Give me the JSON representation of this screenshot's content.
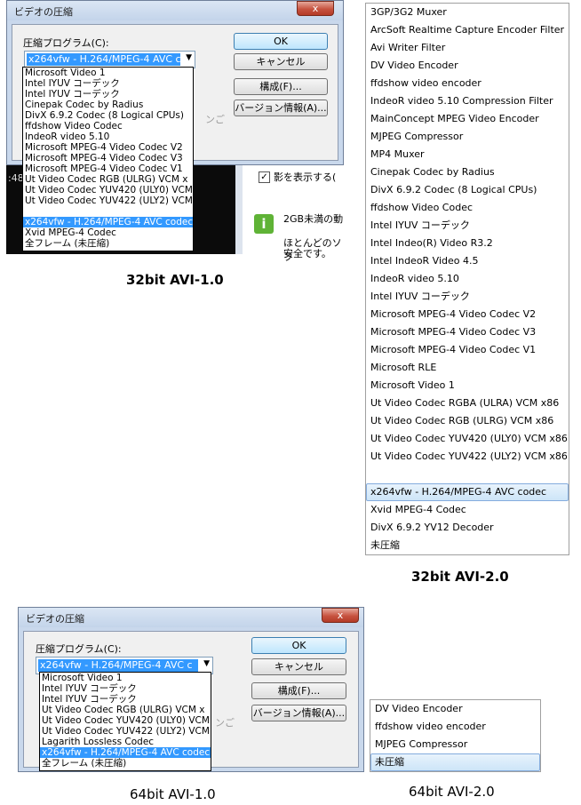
{
  "dialog_title": "ビデオの圧縮",
  "close_glyph": "x",
  "compressor_label": "圧縮プログラム(C):",
  "buttons": {
    "ok": "OK",
    "cancel": "キャンセル",
    "configure": "構成(F)...",
    "about": "バージョン情報(A)..."
  },
  "combo_selected": "x264vfw - H.264/MPEG-4 AVC c",
  "combo_arrow": "▼",
  "ghost_text": "ンご",
  "panel1": {
    "caption": "32bit AVI-1.0",
    "items": [
      "Microsoft Video 1",
      "Intel IYUV コーデック",
      "Intel IYUV コーデック",
      "Cinepak Codec by Radius",
      "DivX 6.9.2 Codec (8 Logical CPUs)",
      "ffdshow Video Codec",
      "IndeoR video 5.10",
      "Microsoft MPEG-4 Video Codec V2",
      "Microsoft MPEG-4 Video Codec V3",
      "Microsoft MPEG-4 Video Codec V1",
      "Ut Video Codec RGB (ULRG) VCM x",
      "Ut Video Codec YUV420 (ULY0) VCM",
      "Ut Video Codec YUV422 (ULY2) VCM",
      "",
      "x264vfw - H.264/MPEG-4 AVC codec",
      "Xvid MPEG-4 Codec",
      "全フレーム (未圧縮)"
    ],
    "highlight_index": 14,
    "bg_time": ":48",
    "bg_checkbox_label": "影を表示する(",
    "bg_info_line1": "2GB未満の動",
    "bg_info_line2": "ほとんどのソフ",
    "bg_info_line3": "安全です。"
  },
  "panel2": {
    "caption": "32bit AVI-2.0",
    "items": [
      "3GP/3G2 Muxer",
      "ArcSoft Realtime Capture Encoder Filter",
      "Avi Writer Filter",
      "DV Video Encoder",
      "ffdshow video encoder",
      "IndeoR video 5.10 Compression Filter",
      "MainConcept MPEG Video Encoder",
      "MJPEG Compressor",
      "MP4 Muxer",
      "Cinepak Codec by Radius",
      "DivX 6.9.2 Codec (8 Logical CPUs)",
      "ffdshow Video Codec",
      "Intel IYUV コーデック",
      "Intel Indeo(R) Video R3.2",
      "Intel IndeoR Video 4.5",
      "IndeoR video 5.10",
      "Intel IYUV コーデック",
      "Microsoft MPEG-4 Video Codec V2",
      "Microsoft MPEG-4 Video Codec V3",
      "Microsoft MPEG-4 Video Codec V1",
      "Microsoft RLE",
      "Microsoft Video 1",
      "Ut Video Codec RGBA (ULRA) VCM x86",
      "Ut Video Codec RGB (ULRG) VCM x86",
      "Ut Video Codec YUV420 (ULY0) VCM x86",
      "Ut Video Codec YUV422 (ULY2) VCM x86",
      "",
      "x264vfw - H.264/MPEG-4 AVC codec",
      "Xvid MPEG-4 Codec",
      "DivX 6.9.2 YV12 Decoder",
      "未圧縮"
    ],
    "highlight_index": 27
  },
  "panel3": {
    "caption": "64bit AVI-1.0",
    "items": [
      "Microsoft Video 1",
      "Intel IYUV コーデック",
      "Intel IYUV コーデック",
      "Ut Video Codec RGB (ULRG) VCM x",
      "Ut Video Codec YUV420 (ULY0) VCM",
      "Ut Video Codec YUV422 (ULY2) VCM",
      "Lagarith Lossless Codec",
      "x264vfw - H.264/MPEG-4 AVC codec",
      "全フレーム (未圧縮)"
    ],
    "highlight_index": 7
  },
  "panel4": {
    "caption": "64bit AVI-2.0",
    "items": [
      "DV Video Encoder",
      "ffdshow video encoder",
      "MJPEG Compressor",
      "未圧縮"
    ],
    "highlight_index": 3
  }
}
